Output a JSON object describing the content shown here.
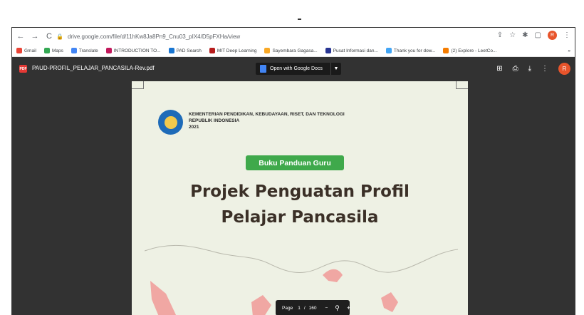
{
  "browser": {
    "url": "drive.google.com/file/d/11hKw8Ja8Pn9_Cnu03_pIX4/D5pFXHa/view",
    "bookmarks": [
      {
        "label": "Gmail",
        "color": "#ea4335"
      },
      {
        "label": "Maps",
        "color": "#34a853"
      },
      {
        "label": "Translate",
        "color": "#4285f4"
      },
      {
        "label": "INTRODUCTION TO...",
        "color": "#c2185b"
      },
      {
        "label": "PAD Search",
        "color": "#1976d2"
      },
      {
        "label": "MIT Deep Learning",
        "color": "#b71c1c"
      },
      {
        "label": "Sayembara Gagasa...",
        "color": "#f9a825"
      },
      {
        "label": "Pusat Informasi dan...",
        "color": "#283593"
      },
      {
        "label": "Thank you for dow...",
        "color": "#42a5f5"
      },
      {
        "label": "(2) Explore - LeetCo...",
        "color": "#f57c00"
      }
    ],
    "more": "»",
    "profile_initial": "R"
  },
  "viewer": {
    "file_name": "PAUD-PROFIL_PELAJAR_PANCASILA-Rev.pdf",
    "open_with_label": "Open with Google Docs",
    "profile_initial": "R"
  },
  "document": {
    "ministry_line1": "KEMENTERIAN PENDIDIKAN, KEBUDAYAAN, RISET, DAN TEKNOLOGI",
    "ministry_line2": "REPUBLIK INDONESIA",
    "year": "2021",
    "badge": "Buku Panduan Guru",
    "title_line1": "Projek Penguatan Profil",
    "title_line2": "Pelajar Pancasila"
  },
  "pager": {
    "page_label": "Page",
    "current": "1",
    "separator": "/",
    "total": "160",
    "zoom_out": "−",
    "zoom_in": "+"
  }
}
